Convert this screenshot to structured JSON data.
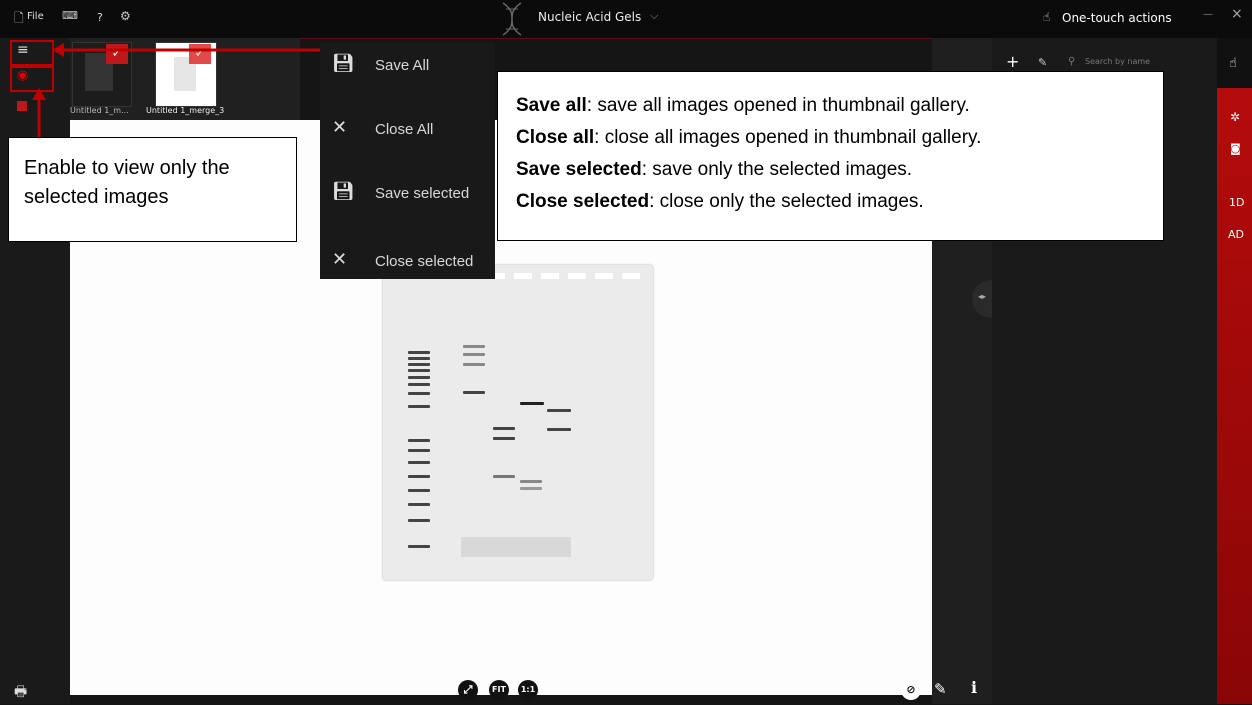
{
  "titlebar": {
    "file_label": "File",
    "help_label": "?",
    "app_title": "Nucleic Acid Gels",
    "one_touch_label": "One-touch actions",
    "minimize": "—",
    "close": "×"
  },
  "thumbnails": [
    {
      "label": "Untitled 1_m...",
      "checked": true
    },
    {
      "label": "Untitled 1_merge_3",
      "checked": true
    }
  ],
  "menu": {
    "items": [
      {
        "label": "Save All",
        "icon": "save-icon"
      },
      {
        "label": "Close All",
        "icon": "close-icon"
      },
      {
        "label": "Save selected",
        "icon": "save-icon"
      },
      {
        "label": "Close selected",
        "icon": "close-icon"
      }
    ]
  },
  "right_toolbar": {
    "add": "+",
    "search_placeholder": "Search by name"
  },
  "red_sidebar": {
    "label_1d": "1D",
    "label_ad": "AD"
  },
  "annotations": {
    "left_callout": "Enable to view only the selected images",
    "desc": [
      {
        "term": "Save all",
        "text": ": save all images opened in thumbnail gallery."
      },
      {
        "term": "Close all",
        "text": ": close all images opened in thumbnail gallery."
      },
      {
        "term": "Save selected",
        "text": ": save only the selected images."
      },
      {
        "term": "Close selected",
        "text": ": close only the selected images."
      }
    ]
  },
  "image_controls": {
    "fit_label": "FIT",
    "one_to_one_label": "1:1",
    "info_label": "i"
  },
  "colors": {
    "accent_red": "#c0181a",
    "annotation_red": "#c00000"
  }
}
